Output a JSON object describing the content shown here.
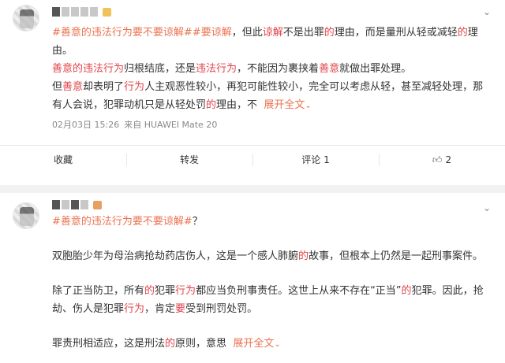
{
  "post1": {
    "tag_topic": "#善意的违法行为要不要谅解#",
    "tag_topic2": "#要谅解",
    "line1_rest": "，但此",
    "line1_word_liangjie": "谅解",
    "line1_mid": "不是出罪",
    "line1_de1": "的",
    "line1_tail": "理由，而是量刑从轻或减轻",
    "line1_de2": "的",
    "line1_end": "理",
    "line2": "由。",
    "para2_hl1": "善意的违法行为",
    "para2_mid": "归根结底，还是",
    "para2_hl2": "违法行为",
    "para2_mid2": "，不能因为裹挟着",
    "para2_hl3": "善意",
    "para2_end": "就做出罪处理。",
    "para3_a": "但",
    "para3_hl1": "善意",
    "para3_b": "却表明了",
    "para3_hl2": "行为",
    "para3_c": "人主观恶性较小，再犯可能性较小，完全可以考虑从轻，甚至减轻处理，那",
    "para3_d": "有人会说，犯罪动机只是从轻处罚",
    "para3_de": "的",
    "para3_e": "理由，不",
    "expand": "展开全文",
    "meta_date": "02月03日 15:26",
    "meta_from": "来自 HUAWEI Mate 20",
    "actions": {
      "collect": "收藏",
      "repost": "转发",
      "comment": "评论 1",
      "like": "2"
    }
  },
  "post2": {
    "line1": "#善意的违法行为要不要谅解#",
    "line1_q": "？",
    "para1_a": "双胞胎少年为母治病抢劫药店伤人，这是一个感人肺腑",
    "para1_de": "的",
    "para1_b": "故事，但根本上仍然是一起刑事案件。",
    "para2_a": "除了正当防卫，所有",
    "para2_de1": "的",
    "para2_b": "犯罪",
    "para2_hl": "行为",
    "para2_c": "都应当负刑事责任。这世上从来不存在“正当”",
    "para2_de2": "的",
    "para2_d": "犯罪。因此，抢",
    "para2_e": "劫、伤人是犯罪",
    "para2_hl2": "行为",
    "para2_f": "，肯定",
    "para2_hl3": "要",
    "para2_g": "受到刑罚处罚。",
    "para3_a": "罪责刑相适应，这是刑法",
    "para3_de": "的",
    "para3_b": "原则，意思",
    "expand": "展开全文"
  },
  "icons": {
    "caret": "chevron-down-icon",
    "like": "thumb-up-icon"
  },
  "colors": {
    "highlight": "#e0444a",
    "link": "#eb7350",
    "meta": "#888888"
  }
}
